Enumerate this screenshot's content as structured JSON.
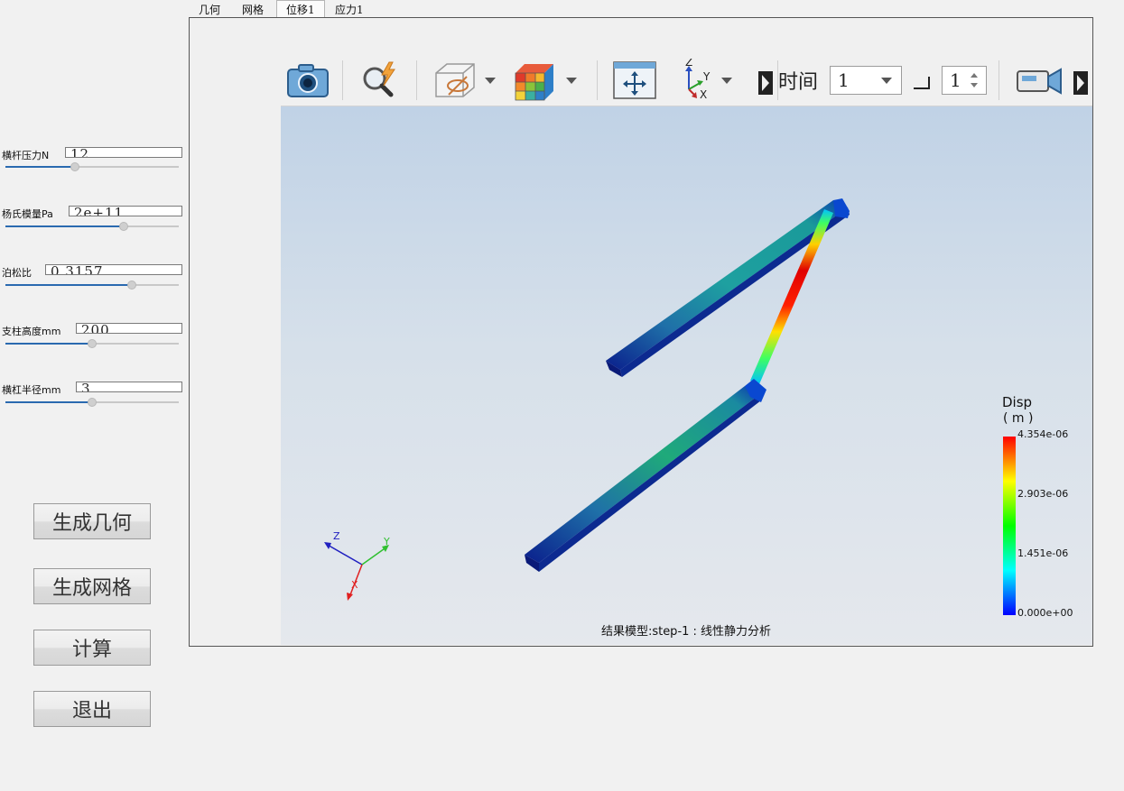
{
  "tabs": [
    "几何",
    "网格",
    "位移1",
    "应力1"
  ],
  "active_tab": 2,
  "params": [
    {
      "label": "横杆压力N",
      "value": "12",
      "slider_fraction": 0.4
    },
    {
      "label": "杨氏模量Pa",
      "value": "2e+11",
      "slider_fraction": 0.68
    },
    {
      "label": "泊松比",
      "value": "0.3157",
      "slider_fraction": 0.73
    },
    {
      "label": "支柱高度mm",
      "value": "200",
      "slider_fraction": 0.5
    },
    {
      "label": "横杠半径mm",
      "value": "3",
      "slider_fraction": 0.5
    }
  ],
  "buttons": {
    "generate_geometry": "生成几何",
    "generate_mesh": "生成网格",
    "compute": "计算",
    "exit": "退出"
  },
  "toolbar": {
    "icons": [
      "camera-icon",
      "zoom-search-icon",
      "visibility-box-icon",
      "color-cube-icon",
      "fit-view-icon",
      "axes-orientation-icon",
      "video-camera-icon"
    ],
    "time_label": "时间",
    "time_value": "1",
    "step_value": "1",
    "axis_labels": {
      "z": "Z",
      "y": "Y",
      "x": "X"
    }
  },
  "viewport": {
    "status_text": "结果模型:step-1 : 线性静力分析",
    "triad": {
      "z": "Z",
      "y": "Y",
      "x": "X"
    },
    "legend": {
      "title": "Disp",
      "unit": "( m )",
      "labels": [
        "4.354e-06",
        "2.903e-06",
        "1.451e-06",
        "0.000e+00"
      ],
      "colors": [
        "#ff0000",
        "#ffff00",
        "#00ff00",
        "#00ffff",
        "#0000ff"
      ]
    }
  }
}
